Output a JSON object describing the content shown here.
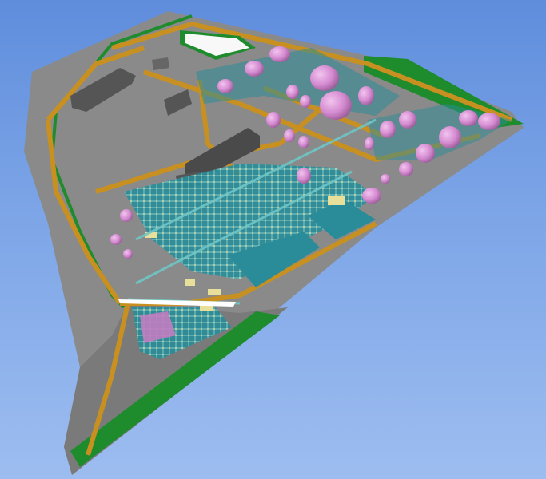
{
  "viewport": {
    "sky_top_color": "#5f8ddc",
    "sky_bottom_color": "#9dbdf0"
  },
  "palette": {
    "ground": "#8a8a8a",
    "ground_dark": "#6f6f6f",
    "road": "#c89020",
    "green_area": "#1e8c2c",
    "tank": "#d48ad0",
    "tank_shade": "#a866a8",
    "process_unit": "#2a8c98",
    "pipe_rack": "#5fb8c8",
    "building": "#555555",
    "equipment_yellow": "#e8e09a",
    "water": "#ffffff"
  },
  "model": {
    "description_shown": "",
    "tank_farms": [
      "north-tank-farm",
      "east-tank-farm"
    ],
    "process_units": [
      "central-process-area",
      "southwest-process-area"
    ]
  }
}
